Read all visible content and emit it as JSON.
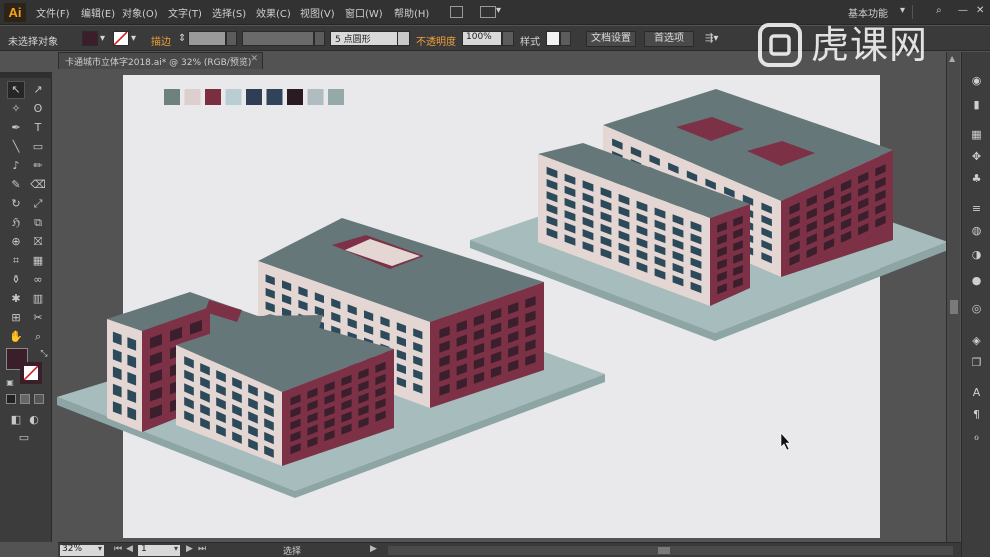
{
  "app": {
    "logo": "Ai"
  },
  "menu": [
    "文件(F)",
    "编辑(E)",
    "对象(O)",
    "文字(T)",
    "选择(S)",
    "效果(C)",
    "视图(V)",
    "窗口(W)",
    "帮助(H)"
  ],
  "workspace": {
    "label": "基本功能"
  },
  "control_bar": {
    "selection_label": "未选择对象",
    "stroke_label": "描边",
    "brush_value": "5 点圆形",
    "opacity_label": "不透明度",
    "opacity_value": "100%",
    "style_label": "样式",
    "doc_setup_button": "文档设置",
    "preferences_button": "首选项"
  },
  "document": {
    "tab_title": "卡通城市立体字2018.ai* @ 32% (RGB/预览)"
  },
  "swatches": [
    "#6f817e",
    "#dccfcd",
    "#7a2e40",
    "#b9cdd5",
    "#2f3d55",
    "#2f4458",
    "#2b1a22",
    "#b0bcc2",
    "#93aaa8"
  ],
  "colors": {
    "roof": "#66777a",
    "window_wall": "#e4d7d3",
    "maroon": "#7c3147",
    "window_dark": "#2d4a5b",
    "window_maroon": "#3c1f2c",
    "base_plate": "#a7bcbc",
    "base_dark": "#8ea5a5",
    "artboard": "#e9e9eb"
  },
  "status": {
    "zoom": "32%",
    "page": "1",
    "tool_status": "选择"
  },
  "watermark": {
    "text": "虎课网"
  },
  "icons": {
    "toolbox": [
      "selection-icon",
      "direct-selection-icon",
      "magic-wand-icon",
      "lasso-icon",
      "pen-icon",
      "type-icon",
      "line-icon",
      "rectangle-icon",
      "paintbrush-icon",
      "pencil-icon",
      "blob-brush-icon",
      "eraser-icon",
      "rotate-icon",
      "scale-icon",
      "warp-icon",
      "free-transform-icon",
      "shape-builder-icon",
      "perspective-grid-icon",
      "mesh-icon",
      "gradient-icon",
      "eyedropper-icon",
      "blend-icon",
      "symbol-sprayer-icon",
      "column-graph-icon",
      "artboard-icon",
      "slice-icon",
      "hand-icon",
      "zoom-icon"
    ],
    "right_panel": [
      "color-icon",
      "color-guide-icon",
      "swatches-icon",
      "brushes-icon",
      "symbols-icon",
      "stroke-icon",
      "gradient-panel-icon",
      "transparency-icon",
      "appearance-icon",
      "graphic-styles-icon",
      "layers-icon",
      "artboards-icon",
      "character-icon",
      "paragraph-icon",
      "opentype-icon"
    ]
  }
}
